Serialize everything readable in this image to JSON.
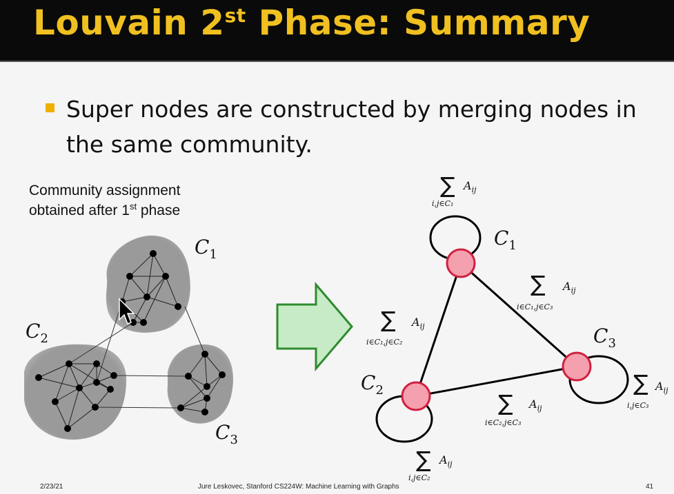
{
  "slide": {
    "title_main": "Louvain 2",
    "title_sup": "st",
    "title_rest": " Phase: Summary",
    "bullet": "Super nodes are constructed by merging nodes in the same community."
  },
  "left_panel": {
    "caption_line1": "Community assignment",
    "caption_line2_pre": "obtained after 1",
    "caption_line2_sup": "st",
    "caption_line2_post": " phase",
    "community_labels": [
      {
        "main": "C",
        "sub": "1"
      },
      {
        "main": "C",
        "sub": "2"
      },
      {
        "main": "C",
        "sub": "3"
      }
    ]
  },
  "right_panel": {
    "super_nodes": [
      {
        "main": "C",
        "sub": "1"
      },
      {
        "main": "C",
        "sub": "2"
      },
      {
        "main": "C",
        "sub": "3"
      }
    ],
    "sum_symbol": "∑",
    "summand": "A",
    "summand_sub": "ij",
    "sum_labels": {
      "self_c1": "i,j∈C₁",
      "c1_c3": "i∈C₁,j∈C₃",
      "c1_c2": "i∈C₁,j∈C₂",
      "self_c3": "i,j∈C₃",
      "c2_c3": "i∈C₂,j∈C₃",
      "self_c2": "i,j∈C₂"
    }
  },
  "colors": {
    "title": "#f0c020",
    "bullet_marker": "#f0b000",
    "community_blob": "#9a9a9a",
    "super_node_fill": "#f4a0ae",
    "super_node_stroke": "#d02040",
    "arrow_fill": "#c6ebc6",
    "arrow_stroke": "#2e8b2e"
  },
  "footer": {
    "date": "2/23/21",
    "credit": "Jure Leskovec, Stanford CS224W: Machine Learning with Graphs",
    "page": "41"
  }
}
